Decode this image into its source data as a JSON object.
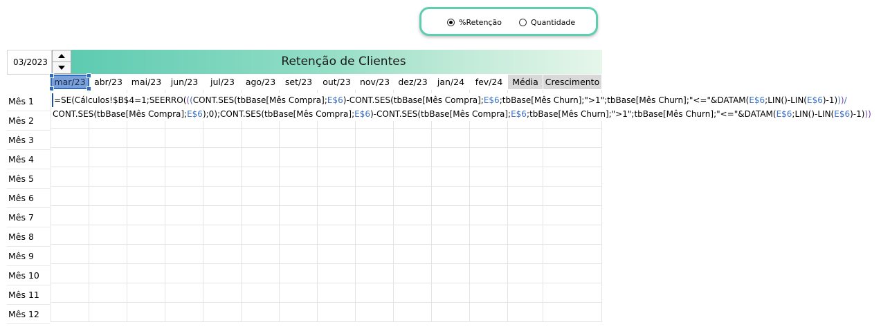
{
  "radio_options": [
    {
      "label": "%Retenção",
      "checked": true
    },
    {
      "label": "Quantidade",
      "checked": false
    }
  ],
  "date_value": "03/2023",
  "title": "Retenção de Clientes",
  "columns": [
    "mar/23",
    "abr/23",
    "mai/23",
    "jun/23",
    "jul/23",
    "ago/23",
    "set/23",
    "out/23",
    "nov/23",
    "dez/23",
    "jan/24",
    "fev/24",
    "Média",
    "Crescimento"
  ],
  "rows": [
    "Mês 1",
    "Mês 2",
    "Mês 3",
    "Mês 4",
    "Mês 5",
    "Mês 6",
    "Mês 7",
    "Mês 8",
    "Mês 9",
    "Mês 10",
    "Mês 11",
    "Mês 12"
  ],
  "formula": {
    "line1": [
      {
        "t": "=SE(Cálculos!$B$4=1;SEERRO(",
        "c": ""
      },
      {
        "t": "(",
        "c": "paren-purple"
      },
      {
        "t": "(",
        "c": "paren-blue"
      },
      {
        "t": "CONT.SES(tbBase[Mês Compra];",
        "c": ""
      },
      {
        "t": "E$6",
        "c": "ref"
      },
      {
        "t": ")-CONT.SES(tbBase[Mês Compra];",
        "c": ""
      },
      {
        "t": "E$6",
        "c": "ref"
      },
      {
        "t": ";tbBase[Mês Churn];\">1\";tbBase[Mês Churn];\"<=\"&DATAM(",
        "c": ""
      },
      {
        "t": "E$6",
        "c": "ref"
      },
      {
        "t": ";LIN()-LIN(",
        "c": ""
      },
      {
        "t": "E$6",
        "c": "ref"
      },
      {
        "t": ")-1)",
        "c": ""
      },
      {
        "t": ")",
        "c": "paren-blue"
      },
      {
        "t": ")",
        "c": "paren-purple"
      },
      {
        "t": "/",
        "c": "paren-blue"
      }
    ],
    "line2": [
      {
        "t": "CONT.SES(tbBase[Mês Compra];",
        "c": ""
      },
      {
        "t": "E$6",
        "c": "ref"
      },
      {
        "t": ");0);CONT.SES(tbBase[Mês Compra];",
        "c": ""
      },
      {
        "t": "E$6",
        "c": "ref"
      },
      {
        "t": ")-CONT.SES(tbBase[Mês Compra];",
        "c": ""
      },
      {
        "t": "E$6",
        "c": "ref"
      },
      {
        "t": ";tbBase[Mês Churn];\">1\";tbBase[Mês Churn];\"<=\"&DATAM(",
        "c": ""
      },
      {
        "t": "E$6",
        "c": "ref"
      },
      {
        "t": ";LIN()-LIN(",
        "c": ""
      },
      {
        "t": "E$6",
        "c": "ref"
      },
      {
        "t": ")-1)",
        "c": ""
      },
      {
        "t": "))",
        "c": "paren-purple"
      }
    ]
  },
  "colors": {
    "accent": "#5fcdb0",
    "selection": "#7aa0d8",
    "reference": "#3a70c9"
  }
}
